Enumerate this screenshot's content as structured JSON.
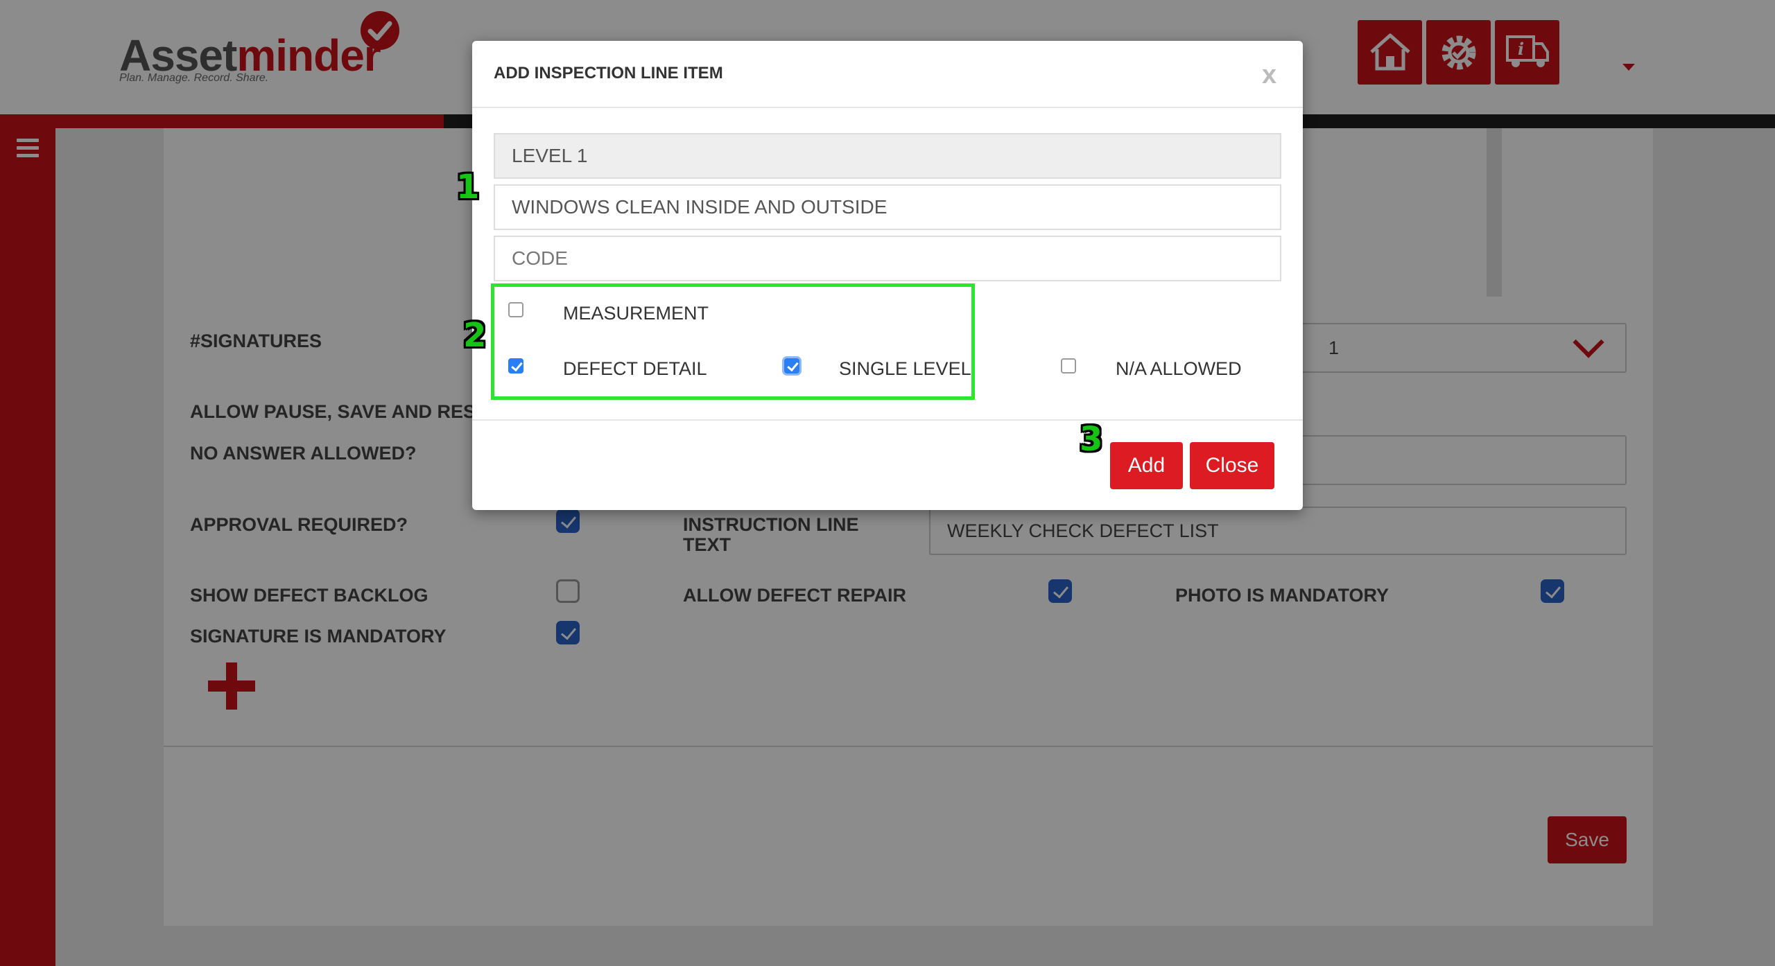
{
  "app": {
    "logo_part1": "Asset",
    "logo_part2": "minder",
    "tagline": "Plan. Manage. Record. Share.",
    "accent_color": "#c9111b",
    "header_icons": [
      "home-icon",
      "settings-icon",
      "truck-info-icon"
    ]
  },
  "progress": {
    "fraction": 0.25
  },
  "form": {
    "signatures_label": "#SIGNATURES",
    "signatures_value": "1",
    "allow_pause_label": "ALLOW PAUSE, SAVE AND RESU",
    "no_answer_label": "NO ANSWER ALLOWED?",
    "approval_label": "APPROVAL REQUIRED?",
    "approval_checked": true,
    "instruction_label_line1": "INSTRUCTION LINE",
    "instruction_label_line2": "TEXT",
    "instruction_value": "WEEKLY CHECK DEFECT LIST",
    "show_backlog_label": "SHOW DEFECT BACKLOG",
    "show_backlog_checked": false,
    "allow_repair_label": "ALLOW DEFECT REPAIR",
    "allow_repair_checked": true,
    "photo_mandatory_label": "PHOTO IS MANDATORY",
    "photo_mandatory_checked": true,
    "signature_mandatory_label": "SIGNATURE IS MANDATORY",
    "signature_mandatory_checked": true,
    "save_label": "Save"
  },
  "modal": {
    "title": "ADD INSPECTION LINE ITEM",
    "close_symbol": "x",
    "level_value": "LEVEL 1",
    "description_value": "WINDOWS CLEAN INSIDE AND OUTSIDE",
    "code_placeholder": "CODE",
    "measurement_label": "MEASUREMENT",
    "measurement_checked": false,
    "defect_detail_label": "DEFECT DETAIL",
    "defect_detail_checked": true,
    "single_level_label": "SINGLE LEVEL",
    "single_level_checked": true,
    "na_allowed_label": "N/A ALLOWED",
    "na_allowed_checked": false,
    "add_label": "Add",
    "close_label": "Close"
  },
  "annotations": {
    "step1": "1",
    "step2": "2",
    "step3": "3",
    "highlight_color": "#2ee52e"
  }
}
